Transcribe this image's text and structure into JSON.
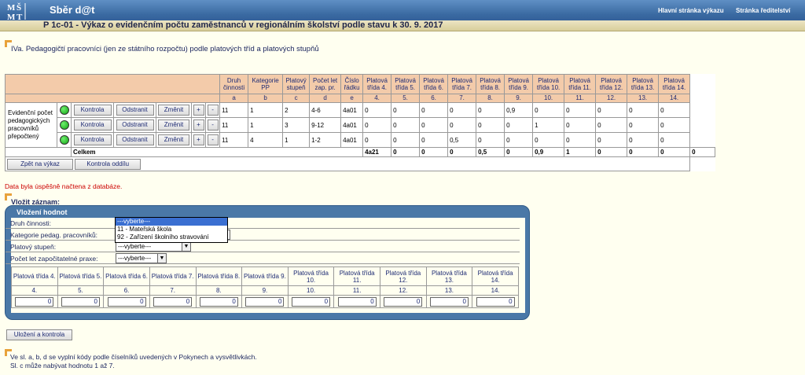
{
  "header": {
    "logo_text": "MŠMT",
    "app_title": "Sběr d@t",
    "links": [
      "Hlavní stránka výkazu",
      "Stránka ředitelství"
    ]
  },
  "report_title": "P 1c-01 - Výkaz o evidenčním počtu zaměstnanců v regionálním školství podle stavu k 30. 9. 2017",
  "section_title": "IVa. Pedagogičtí pracovníci (jen ze státního rozpočtu) podle platových tříd a platových stupňů",
  "table": {
    "headers": [
      "Druh činnosti",
      "Kategorie PP",
      "Platový stupeň",
      "Počet let zap. pr.",
      "Číslo řádku",
      "Platová třída 4.",
      "Platová třída 5.",
      "Platová třída 6.",
      "Platová třída 7.",
      "Platová třída 8.",
      "Platová třída 9.",
      "Platová třída 10.",
      "Platová třída 11.",
      "Platová třída 12.",
      "Platová třída 13.",
      "Platová třída 14."
    ],
    "letters": [
      "a",
      "b",
      "c",
      "d",
      "e",
      "4.",
      "5.",
      "6.",
      "7.",
      "8.",
      "9.",
      "10.",
      "11.",
      "12.",
      "13.",
      "14."
    ],
    "row_label": "Evidenční počet pedagogických pracovníků přepočtený",
    "buttons": {
      "check": "Kontrola",
      "remove": "Odstranit",
      "edit": "Změnit",
      "plus": "+",
      "minus": "-"
    },
    "rows": [
      [
        "11",
        "1",
        "2",
        "4-6",
        "4a01",
        "0",
        "0",
        "0",
        "0",
        "0",
        "0,9",
        "0",
        "0",
        "0",
        "0",
        "0"
      ],
      [
        "11",
        "1",
        "3",
        "9-12",
        "4a01",
        "0",
        "0",
        "0",
        "0",
        "0",
        "0",
        "1",
        "0",
        "0",
        "0",
        "0"
      ],
      [
        "11",
        "4",
        "1",
        "1-2",
        "4a01",
        "0",
        "0",
        "0",
        "0,5",
        "0",
        "0",
        "0",
        "0",
        "0",
        "0",
        "0"
      ]
    ],
    "total_label": "Celkem",
    "total_row_no": "4a21",
    "totals": [
      "0",
      "0",
      "0",
      "0,5",
      "0",
      "0,9",
      "1",
      "0",
      "0",
      "0",
      "0"
    ],
    "back_button": "Zpět na výkaz",
    "section_check_button": "Kontrola oddílu"
  },
  "status_message": "Data byla úspěšně načtena z databáze.",
  "insert": {
    "label": "Vložit záznam:",
    "panel_title": "Vložení hodnot",
    "fields": [
      {
        "label": "Druh činnosti:",
        "value": "---vyberte---"
      },
      {
        "label": "Kategorie pedag. pracovníků:",
        "value": ""
      },
      {
        "label": "Platový stupeň:",
        "value": "---vyberte---"
      },
      {
        "label": "Počet let započitatelné praxe:",
        "value": "---vyberte---"
      }
    ],
    "dropdown_options": [
      "---vyberte---",
      "11 - Mateřská škola",
      "92 - Zařízení školního stravování"
    ],
    "grid_headers": [
      "Platová třída 4.",
      "Platová třída 5.",
      "Platová třída 6.",
      "Platová třída 7.",
      "Platová třída 8.",
      "Platová třída 9.",
      "Platová třída 10.",
      "Platová třída 11.",
      "Platová třída 12.",
      "Platová třída 13.",
      "Platová třída 14."
    ],
    "grid_numbers": [
      "4.",
      "5.",
      "6.",
      "7.",
      "8.",
      "9.",
      "10.",
      "11.",
      "12.",
      "13.",
      "14."
    ],
    "grid_values": [
      "0",
      "0",
      "0",
      "0",
      "0",
      "0",
      "0",
      "0",
      "0",
      "0",
      "0"
    ],
    "save_button": "Uložení a kontrola"
  },
  "notes": [
    "Ve sl. a, b, d se vyplní kódy podle číselníků uvedených v Pokynech a vysvětlivkách.",
    "Sl. c může nabývat hodnotu 1 až 7."
  ],
  "colors": {
    "header_blue": "#3a6aa2",
    "table_header": "#f3cbaa",
    "panel_blue": "#4a78a7",
    "status_ok": "#00aa00",
    "message_red": "#cc0000"
  }
}
